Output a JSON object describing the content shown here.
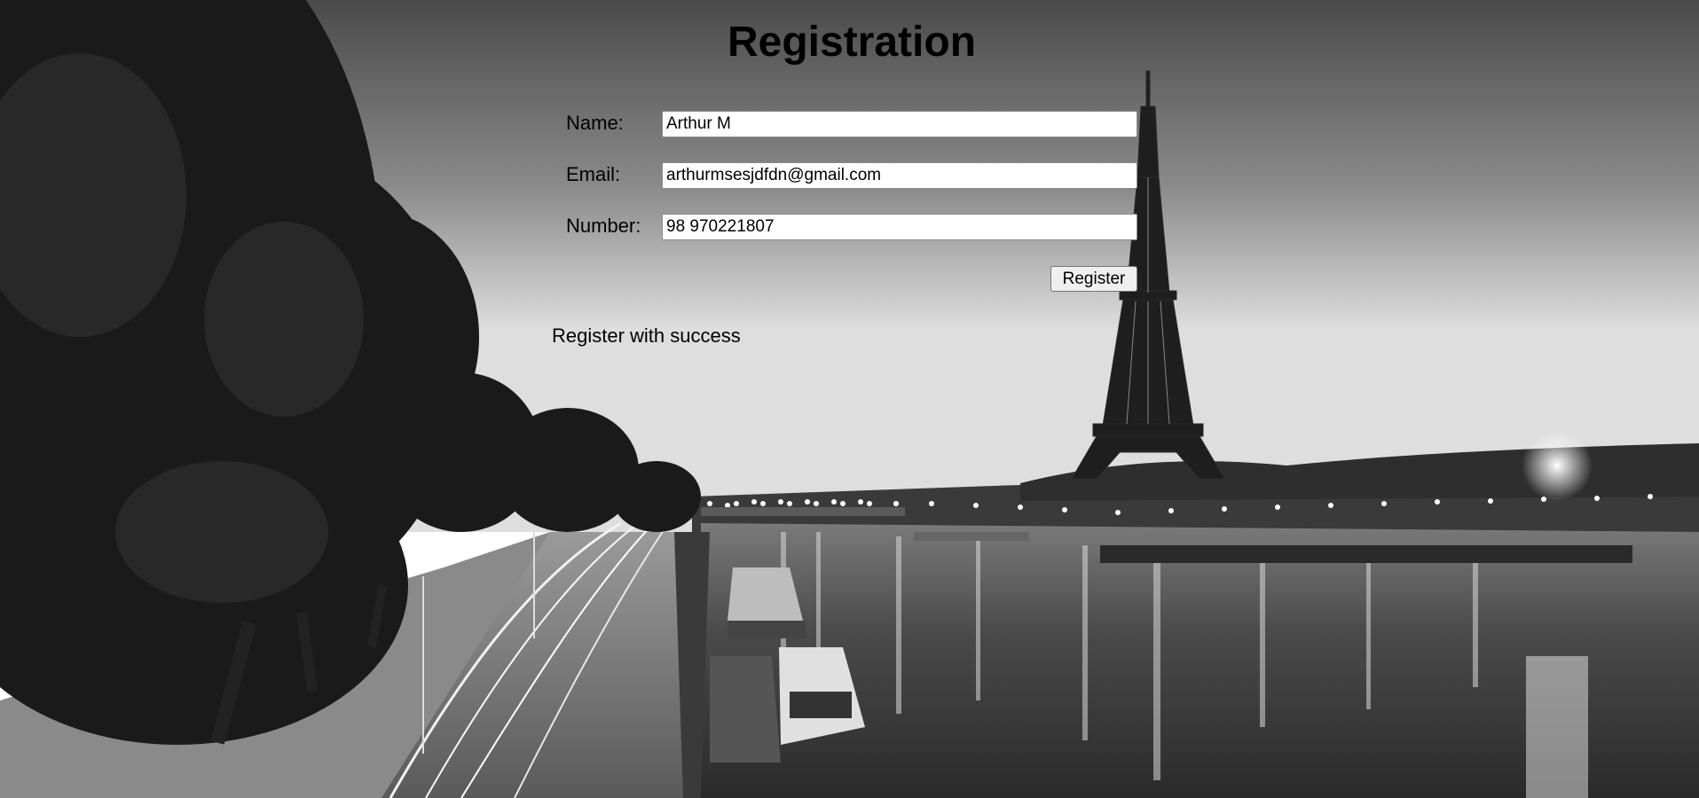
{
  "page": {
    "title": "Registration"
  },
  "form": {
    "name_label": "Name:",
    "name_value": "Arthur M",
    "email_label": "Email:",
    "email_value": "arthurmsesjdfdn@gmail.com",
    "number_label": "Number:",
    "number_value": "98 970221807",
    "register_label": "Register"
  },
  "status": {
    "message": "Register with success"
  },
  "background": {
    "subject": "Black and white night photo of the Seine river in Paris with the Eiffel Tower, tree-lined road with light trails, and moored houseboats"
  }
}
